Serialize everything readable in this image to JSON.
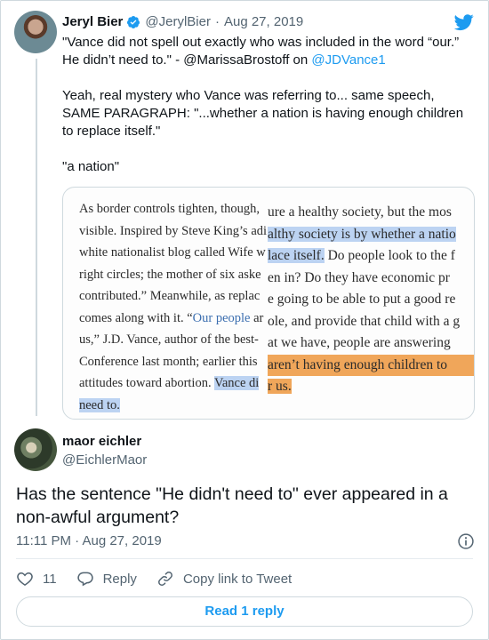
{
  "colors": {
    "accent": "#1d9bf0",
    "secondary_text": "#536471",
    "border": "#cfd9de"
  },
  "quoted_tweet": {
    "author_name": "Jeryl Bier",
    "author_handle": "@JerylBier",
    "separator": "·",
    "date": "Aug 27, 2019",
    "line1_a": "\"Vance did not spell out exactly who was included in the word “our.”",
    "line2_a": "He didn’t need to.\" - @MarissaBrostoff on ",
    "line2_link": "@JDVance1",
    "line3": "Yeah, real mystery who Vance was referring to... same speech,",
    "line4": "SAME PARAGRAPH: \"...whether a nation is having enough children",
    "line5": "to replace itself.\"",
    "line6": "\"a nation\""
  },
  "image": {
    "left_lines": [
      "As border controls tighten, though,",
      "visible. Inspired by Steve King’s adi",
      "white nationalist blog called Wife w",
      "right circles; the mother of six aske",
      "contributed.” Meanwhile, as replac",
      "comes along with it. “",
      "us,” J.D. Vance, author of the best-",
      "Conference last month; earlier this",
      "attitudes toward abortion. ",
      "need to."
    ],
    "left_link": "Our people",
    "left_link_after": " ar",
    "left_highlight_1": "Vance di",
    "right_lines": [
      "ure a healthy society, but the mos",
      "althy society is by whether a natio",
      "lace itself.",
      " Do people look to the f",
      "en in? Do they have economic pr",
      "e going to be able to put a good re",
      "ole, and provide that child with a g",
      "at we have, people are answering",
      " aren’t having enough children to",
      "r us."
    ]
  },
  "reply": {
    "author_name": "maor eichler",
    "author_handle": "@EichlerMaor",
    "body": "Has the sentence \"He didn't need to\" ever appeared in a non-awful argument?",
    "time": "11:11 PM · Aug 27, 2019"
  },
  "actions": {
    "like_count": "11",
    "reply_label": "Reply",
    "copy_label": "Copy link to Tweet",
    "read_replies_label": "Read 1 reply"
  }
}
